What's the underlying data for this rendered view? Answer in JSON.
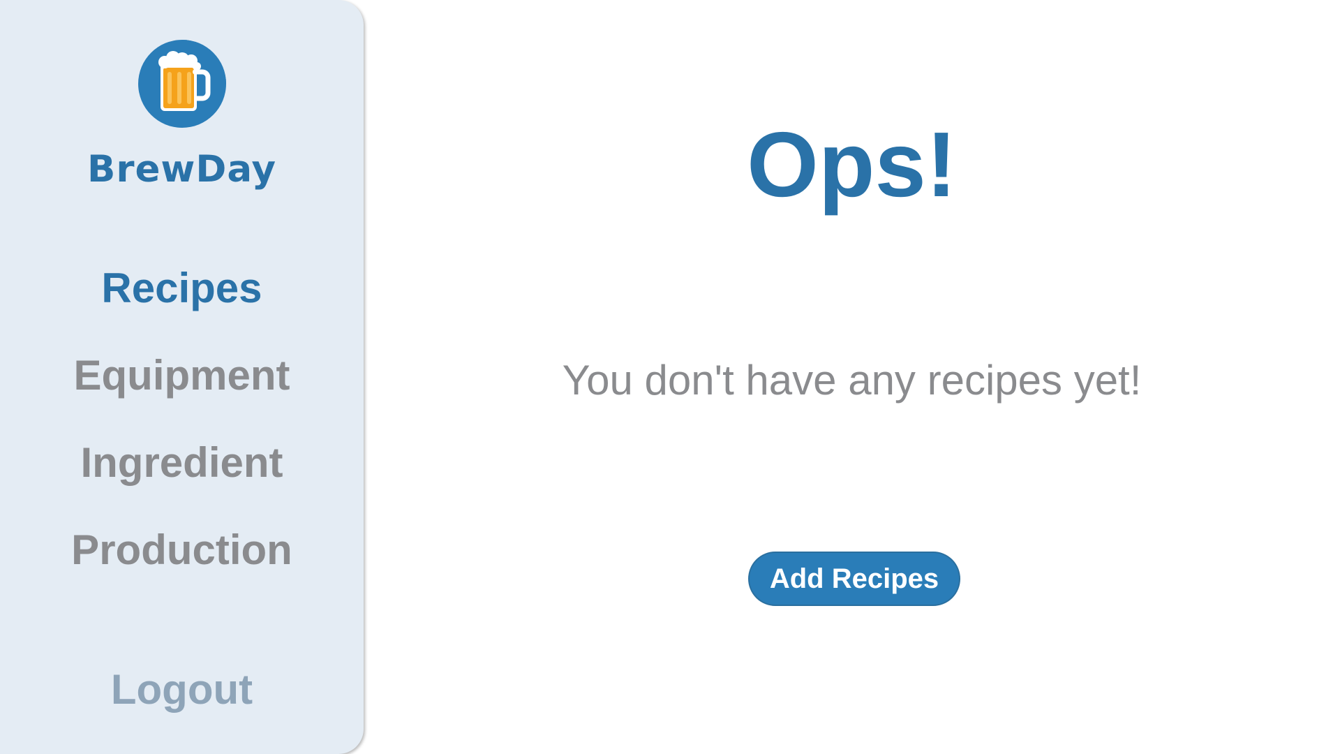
{
  "sidebar": {
    "logo_icon": "beer-mug-icon",
    "brand": "BrewDay",
    "items": [
      {
        "label": "Recipes",
        "active": true
      },
      {
        "label": "Equipment",
        "active": false
      },
      {
        "label": "Ingredient",
        "active": false
      },
      {
        "label": "Production",
        "active": false
      }
    ],
    "logout_label": "Logout"
  },
  "main": {
    "title": "Ops!",
    "message": "You don't have any recipes yet!",
    "add_button_label": "Add Recipes"
  },
  "colors": {
    "accent": "#2a72a8",
    "sidebar_bg": "#e4ecf4",
    "inactive_text": "#8a8b8e",
    "logout_text": "#8ea4b8"
  }
}
